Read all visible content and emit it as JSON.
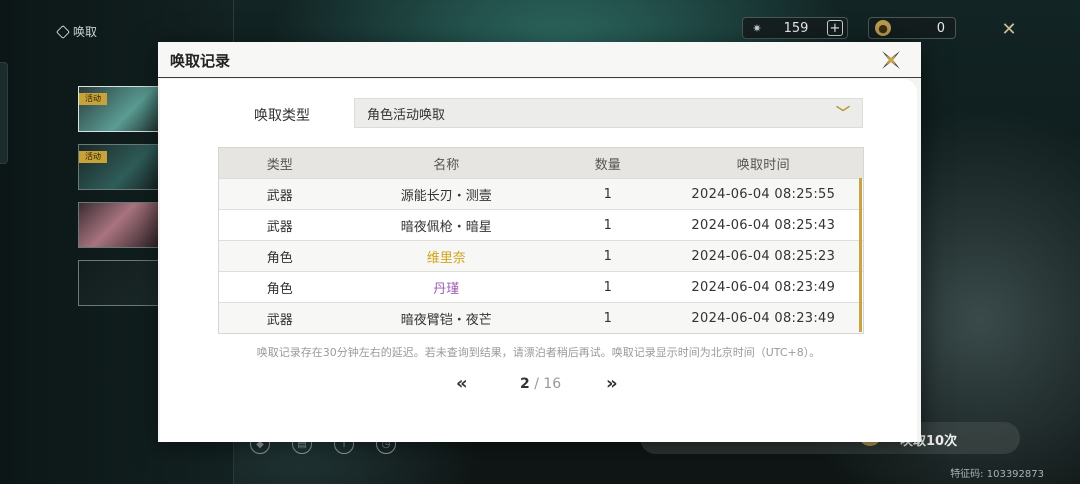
{
  "background": {
    "nav_label": "唤取",
    "banner_tags": [
      "活动",
      "活动"
    ],
    "currencies": [
      {
        "icon": "star-currency-icon",
        "value": "159"
      },
      {
        "icon": "coin-currency-icon",
        "value": "0"
      }
    ],
    "pull_ten_label": "唤取10次",
    "uid_text": "特征码: 103392873"
  },
  "modal": {
    "title": "唤取记录",
    "type_label": "唤取类型",
    "type_selected": "角色活动唤取",
    "columns": [
      "类型",
      "名称",
      "数量",
      "唤取时间"
    ],
    "rows": [
      {
        "type": "武器",
        "name": "源能长刃・测壹",
        "qty": "1",
        "time": "2024-06-04 08:25:55",
        "color": "#333333"
      },
      {
        "type": "武器",
        "name": "暗夜佩枪・暗星",
        "qty": "1",
        "time": "2024-06-04 08:25:43",
        "color": "#333333"
      },
      {
        "type": "角色",
        "name": "维里奈",
        "qty": "1",
        "time": "2024-06-04 08:25:23",
        "color": "#d1a417"
      },
      {
        "type": "角色",
        "name": "丹瑾",
        "qty": "1",
        "time": "2024-06-04 08:23:49",
        "color": "#9b5fb0"
      },
      {
        "type": "武器",
        "name": "暗夜臂铠・夜芒",
        "qty": "1",
        "time": "2024-06-04 08:23:49",
        "color": "#333333"
      }
    ],
    "notice": "唤取记录存在30分钟左右的延迟。若未查询到结果，请漂泊者稍后再试。唤取记录显示时间为北京时间（UTC+8）。",
    "pager": {
      "prev": "«",
      "next": "»",
      "current": "2",
      "separator": " / ",
      "total": "16"
    }
  },
  "colors": {
    "accent_gold": "#c9a445",
    "five_star": "#d1a417",
    "four_star": "#9b5fb0"
  }
}
